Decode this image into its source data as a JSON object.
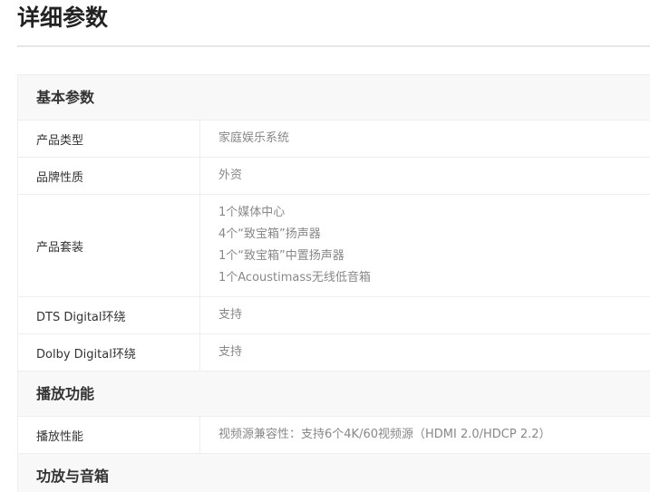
{
  "page": {
    "title": "详细参数"
  },
  "sections": [
    {
      "title": "基本参数",
      "rows": [
        {
          "label": "产品类型",
          "values": [
            "家庭娱乐系统"
          ]
        },
        {
          "label": "品牌性质",
          "values": [
            "外资"
          ]
        },
        {
          "label": "产品套装",
          "values": [
            "1个媒体中心",
            "4个“致宝箱”扬声器",
            "1个“致宝箱”中置扬声器",
            "1个Acoustimass无线低音箱"
          ]
        },
        {
          "label": "DTS Digital环绕",
          "values": [
            "支持"
          ]
        },
        {
          "label": "Dolby Digital环绕",
          "values": [
            "支持"
          ]
        }
      ]
    },
    {
      "title": "播放功能",
      "rows": [
        {
          "label": "播放性能",
          "values": [
            "视频源兼容性：支持6个4K/60视频源（HDMI 2.0/HDCP 2.2）"
          ]
        }
      ]
    },
    {
      "title": "功放与音箱",
      "rows": []
    }
  ]
}
